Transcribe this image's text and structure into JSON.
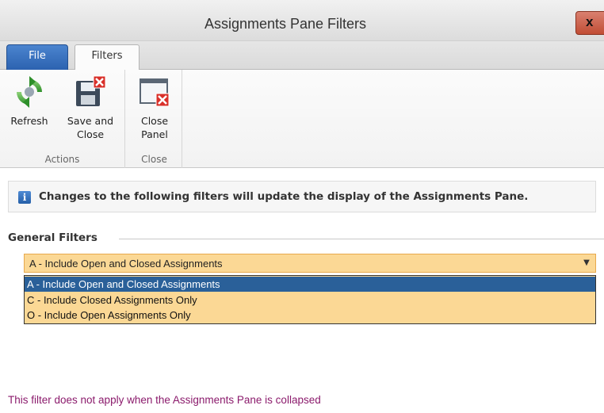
{
  "window": {
    "title": "Assignments Pane Filters",
    "close_label": "x"
  },
  "tabs": [
    {
      "label": "File",
      "active": false
    },
    {
      "label": "Filters",
      "active": true
    }
  ],
  "ribbon": {
    "groups": [
      {
        "label": "Actions",
        "buttons": [
          {
            "label": "Refresh",
            "icon": "refresh-icon"
          },
          {
            "label_line1": "Save and",
            "label_line2": "Close",
            "icon": "save-close-icon"
          }
        ]
      },
      {
        "label": "Close",
        "buttons": [
          {
            "label_line1": "Close",
            "label_line2": "Panel",
            "icon": "close-panel-icon"
          }
        ]
      }
    ]
  },
  "info": {
    "icon": "info-icon",
    "text": "Changes to the following filters will update the display of the Assignments Pane."
  },
  "general_filters": {
    "title": "General Filters",
    "selected_value": "A - Include Open and Closed Assignments",
    "options": [
      "A - Include Open and Closed Assignments",
      "C - Include Closed Assignments Only",
      "O - Include Open Assignments Only"
    ],
    "selected_index": 0
  },
  "note": "This filter does not apply when the Assignments Pane is collapsed",
  "colors": {
    "combo_bg": "#fbd895",
    "selection": "#2a6099",
    "note": "#8b1b6c",
    "file_tab": "#2c62b0"
  }
}
